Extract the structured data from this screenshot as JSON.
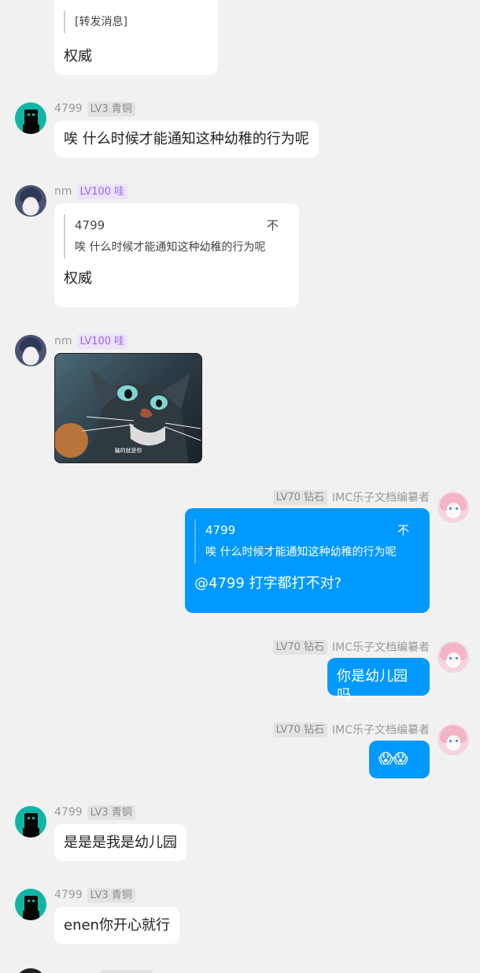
{
  "messages": {
    "m1": {
      "forward": "[转发消息]",
      "text": "权威"
    },
    "m2": {
      "name": "4799",
      "level": "LV3 青铜",
      "text": "唉 什么时候才能通知这种幼稚的行为呢"
    },
    "m3": {
      "name": "nm",
      "level": "LV100 哇",
      "quote_name": "4799",
      "quote_mark": "不",
      "quote_text": "唉 什么时候才能通知这种幼稚的行为呢",
      "text": "权威"
    },
    "m4": {
      "name": "nm",
      "level": "LV100 哇",
      "image_caption": "骗的就是你"
    },
    "m5": {
      "name": "IMC乐子文档编纂者",
      "level": "LV70 钻石",
      "quote_name": "4799",
      "quote_mark": "不",
      "quote_text": "唉 什么时候才能通知这种幼稚的行为呢",
      "text": "@4799 打字都打不对?"
    },
    "m6": {
      "name": "IMC乐子文档编纂者",
      "level": "LV70 钻石",
      "text": "你是幼儿园吗"
    },
    "m7": {
      "name": "IMC乐子文档编纂者",
      "level": "LV70 钻石",
      "text": "😱😱"
    },
    "m8": {
      "name": "4799",
      "level": "LV3 青铜",
      "text": "是是是我是幼儿园"
    },
    "m9": {
      "name": "4799",
      "level": "LV3 青铜",
      "text": "enen你开心就行"
    }
  },
  "colors": {
    "self_bubble": "#0099ff",
    "background": "#f1f1f1",
    "badge_purple": "#9b6ae0"
  },
  "icons": {
    "avatar_robot": "robot-avatar-icon",
    "avatar_anime": "anime-girl-avatar-icon",
    "avatar_pink": "pink-hair-avatar-icon"
  }
}
